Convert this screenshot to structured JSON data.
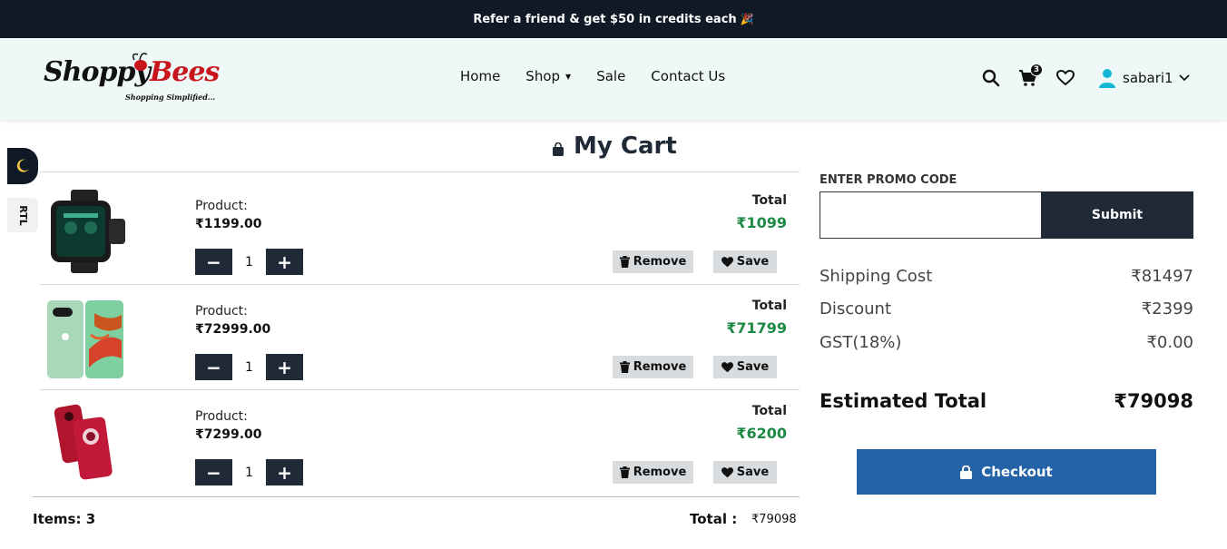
{
  "announcement": {
    "text": "Refer a friend & get $50 in credits each",
    "emoji": "🎉"
  },
  "logo": {
    "brand_part1": "Shoppy",
    "brand_part2": "Bees",
    "tagline": "Shopping Simplified..."
  },
  "nav": [
    {
      "label": "Home"
    },
    {
      "label": "Shop",
      "has_dropdown": true
    },
    {
      "label": "Sale"
    },
    {
      "label": "Contact Us"
    }
  ],
  "header": {
    "cart_count": "3",
    "username": "sabari1"
  },
  "side": {
    "dark_mode_icon": "moon-icon",
    "rtl_label": "RTL"
  },
  "cart": {
    "title": "My Cart",
    "product_label": "Product:",
    "total_label": "Total",
    "remove_label": "Remove",
    "save_label": "Save",
    "items": [
      {
        "image": "smartwatch",
        "price": "₹1199.00",
        "qty": "1",
        "total": "₹1099"
      },
      {
        "image": "green-phone",
        "price": "₹72999.00",
        "qty": "1",
        "total": "₹71799"
      },
      {
        "image": "red-phone",
        "price": "₹7299.00",
        "qty": "1",
        "total": "₹6200"
      }
    ],
    "footer_items": "Items: 3",
    "footer_total_label": "Total :",
    "footer_total_value": "₹79098"
  },
  "promo": {
    "label": "ENTER PROMO CODE",
    "value": "",
    "placeholder": "",
    "button": "Submit"
  },
  "summary": {
    "rows": [
      {
        "label": "Shipping Cost",
        "value": "₹81497"
      },
      {
        "label": "Discount",
        "value": "₹2399"
      },
      {
        "label": "GST(18%)",
        "value": "₹0.00"
      }
    ],
    "estimated_label": "Estimated Total",
    "estimated_value": "₹79098",
    "checkout_label": "Checkout"
  },
  "colors": {
    "dark": "#0f1a26",
    "navy": "#1f2a36",
    "green": "#1d8a45",
    "checkout": "#2563a8",
    "header_bg": "#edf8f7"
  }
}
